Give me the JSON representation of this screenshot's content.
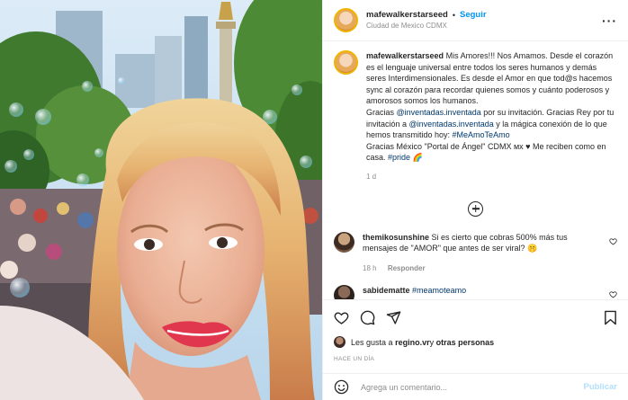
{
  "post": {
    "author": {
      "username": "mafewalkerstarseed",
      "separator": "•",
      "follow_label": "Seguir",
      "location": "Ciudad de Mexico CDMX",
      "more_icon": "more-options-icon"
    },
    "caption": {
      "username": "mafewalkerstarseed",
      "text_1": "Mis Amores!!! Nos Amamos. Desde el corazón es el lenguaje universal entre todos los seres humanos y demás seres Interdimensionales. Es desde el Amor en que tod@s hacemos sync al corazón para recordar quienes somos y cuánto poderosos y amorosos somos los humanos.",
      "text_2a": "Gracias ",
      "mention_1": "@inventadas.inventada",
      "text_2b": " por su invitación. Gracias Rey por tu invitación a ",
      "mention_2": "@inventadas.inventada",
      "text_2c": " y la mágica conexión de lo que hemos transmitido hoy: ",
      "hashtag_1": "#MeAmoTeAmo",
      "text_3": "Gracias México \"Portal de Ángel\" CDMX ᴍx ♥ Me reciben como en casa. ",
      "hashtag_2": "#pride",
      "emoji": "🌈",
      "age": "1 d"
    },
    "comments": [
      {
        "username": "themikosunshine",
        "text": "Si es cierto que cobras 500% más tus mensajes de \"AMOR\" que antes de ser viral? 🤫",
        "age": "18 h",
        "reply_label": "Responder"
      },
      {
        "username": "sabidematte",
        "text": "#meamoteamo"
      }
    ],
    "likes": {
      "prefix": "Les gusta a ",
      "user": "regino.vr",
      "middle": " y ",
      "others": "otras personas"
    },
    "timestamp": "HACE UN DÍA",
    "add_comment": {
      "placeholder": "Agrega un comentario...",
      "publish_label": "Publicar"
    }
  },
  "colors": {
    "link_blue": "#0095f6",
    "mention_blue": "#00376b",
    "muted_gray": "#8e8e8e",
    "text": "#262626",
    "publish_disabled": "#b2dffc"
  }
}
